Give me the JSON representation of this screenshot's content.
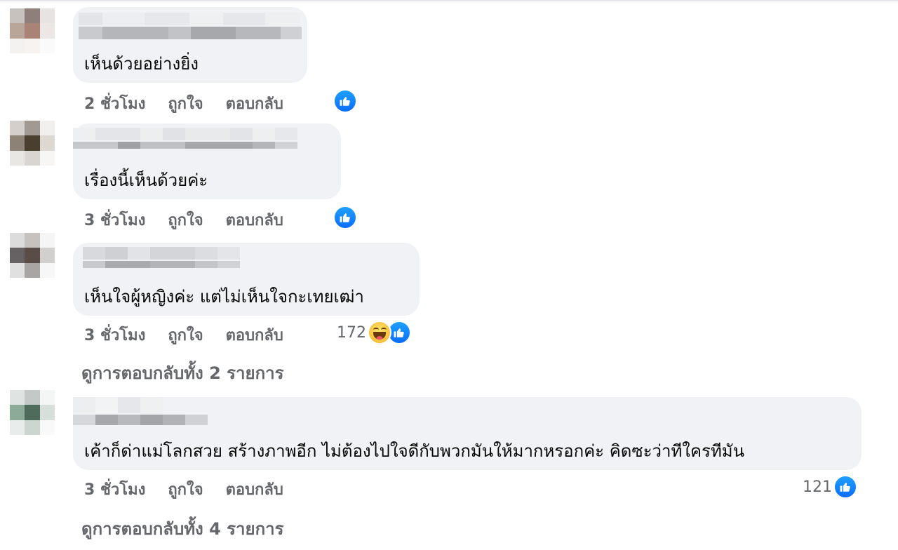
{
  "colors": {
    "like_blue": "#0a6cff",
    "bubble_bg": "#f0f2f5",
    "meta_gray": "#65676b"
  },
  "comments": [
    {
      "text": "เห็นด้วยอย่างยิ่ง",
      "time": "2 ชั่วโมง",
      "like_label": "ถูกใจ",
      "reply_label": "ตอบกลับ",
      "reaction_count": "",
      "reaction_icons": [
        "like-icon"
      ]
    },
    {
      "text": "เรื่องนี้เห็นด้วยค่ะ",
      "time": "3 ชั่วโมง",
      "like_label": "ถูกใจ",
      "reply_label": "ตอบกลับ",
      "reaction_count": "",
      "reaction_icons": [
        "like-icon"
      ]
    },
    {
      "text": "เห็นใจผู้หญิงค่ะ แต่ไม่เห็นใจกะเทยเฒ่า",
      "time": "3 ชั่วโมง",
      "like_label": "ถูกใจ",
      "reply_label": "ตอบกลับ",
      "reaction_count": "172",
      "reaction_icons": [
        "haha-icon",
        "like-icon"
      ],
      "view_replies": "ดูการตอบกลับทั้ง 2 รายการ"
    },
    {
      "text": "เค้าก็ด่าแม่โลกสวย สร้างภาพอีก ไม่ต้องไปใจดีกับพวกมันให้มากหรอกค่ะ คิดซะว่าทีใครทีมัน",
      "time": "3 ชั่วโมง",
      "like_label": "ถูกใจ",
      "reply_label": "ตอบกลับ",
      "reaction_count": "121",
      "reaction_icons": [
        "like-icon"
      ],
      "view_replies": "ดูการตอบกลับทั้ง 4 รายการ"
    }
  ]
}
